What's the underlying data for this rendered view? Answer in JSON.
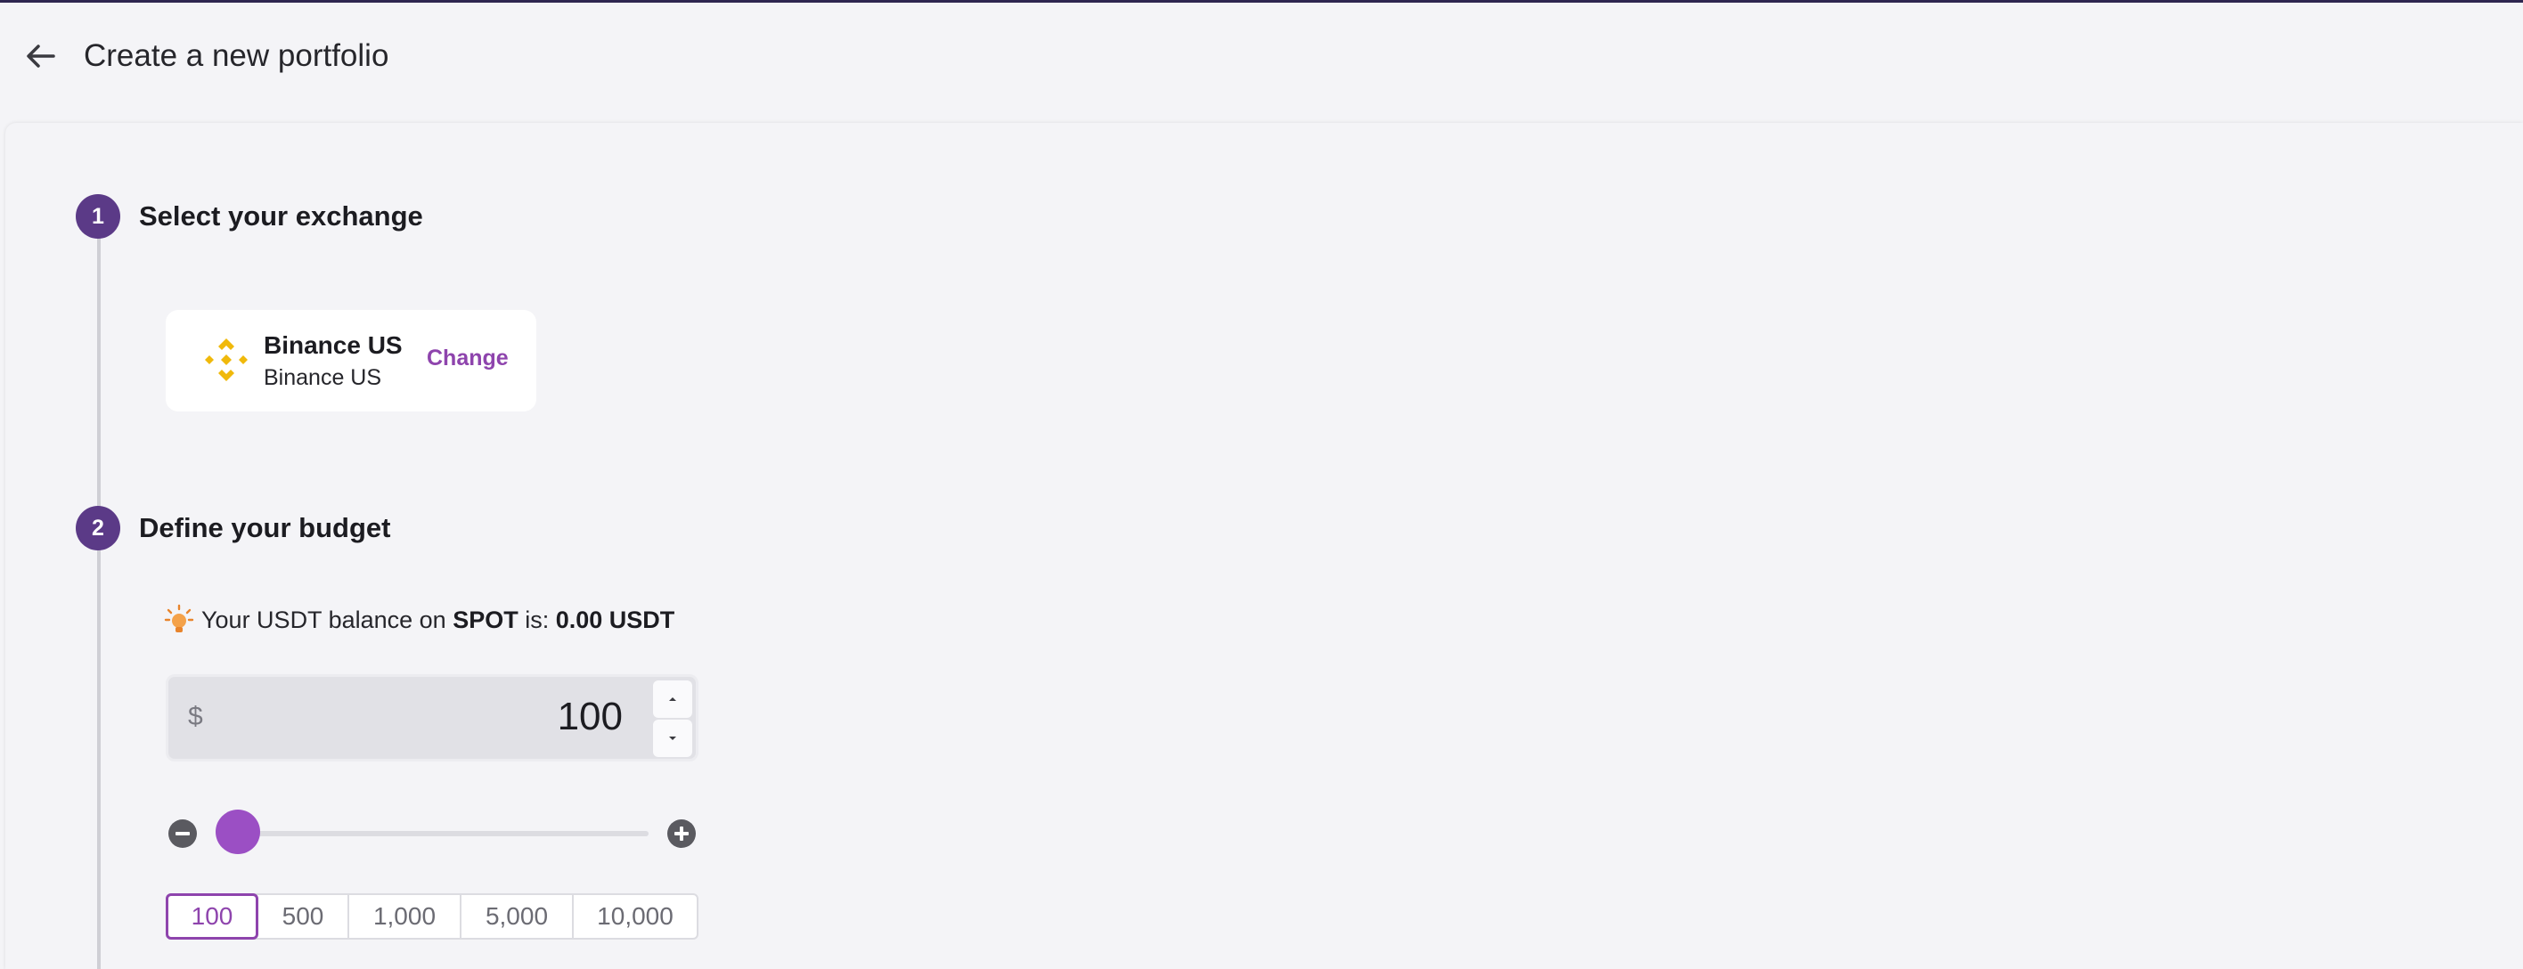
{
  "header": {
    "title": "Create a new portfolio",
    "back_icon": "arrow-left-icon"
  },
  "colors": {
    "accent": "#8e44ad",
    "step_circle": "#5b3a87",
    "slider_thumb": "#9b4fc4",
    "binance_yellow": "#f0b90b"
  },
  "steps": [
    {
      "number": "1",
      "title": "Select your exchange",
      "exchange": {
        "name": "Binance US",
        "subtitle": "Binance US",
        "change_label": "Change",
        "logo_icon": "binance-logo-icon"
      }
    },
    {
      "number": "2",
      "title": "Define your budget",
      "balance": {
        "prefix": "Your USDT balance on",
        "account": "SPOT",
        "middle": "is:",
        "amount": "0.00 USDT",
        "icon": "lightbulb-icon"
      },
      "input": {
        "currency": "$",
        "value": "100"
      },
      "presets": [
        "100",
        "500",
        "1,000",
        "5,000",
        "10,000"
      ],
      "selected_preset": "100",
      "slider_level": 0
    }
  ]
}
